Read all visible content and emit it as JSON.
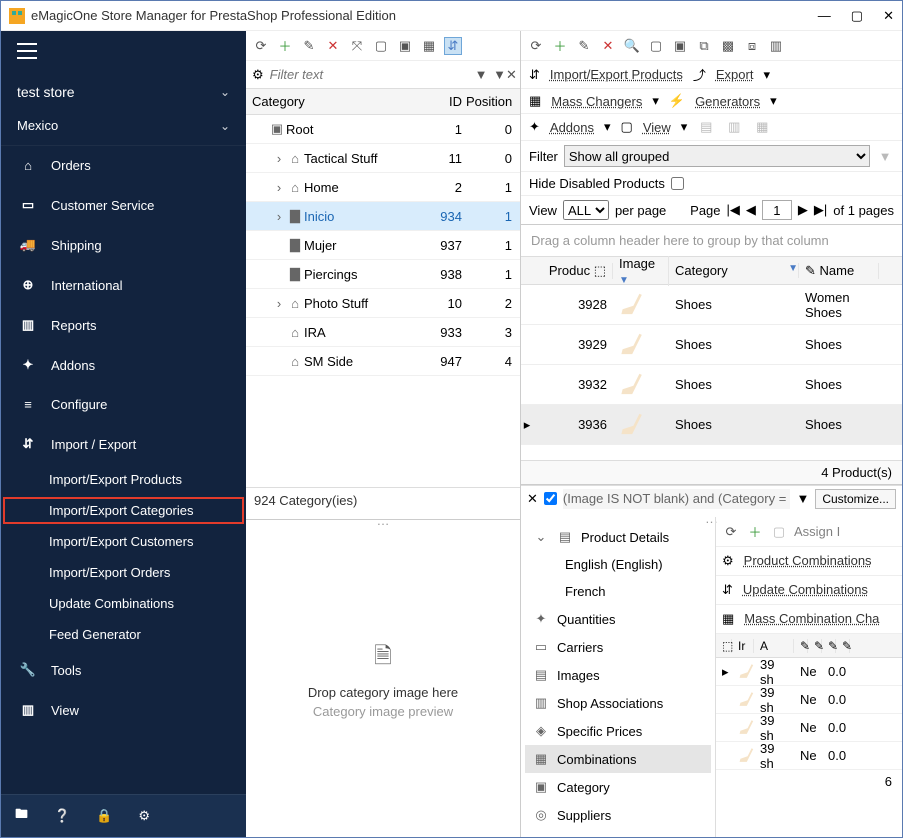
{
  "window": {
    "title": "eMagicOne Store Manager for PrestaShop Professional Edition"
  },
  "sidebar": {
    "store": "test store",
    "region": "Mexico",
    "nav": [
      {
        "icon": "⌂",
        "label": "Orders"
      },
      {
        "icon": "▭",
        "label": "Customer Service"
      },
      {
        "icon": "🚚",
        "label": "Shipping"
      },
      {
        "icon": "⊕",
        "label": "International"
      },
      {
        "icon": "▥",
        "label": "Reports"
      },
      {
        "icon": "✦",
        "label": "Addons"
      },
      {
        "icon": "≡",
        "label": "Configure"
      },
      {
        "icon": "⇵",
        "label": "Import / Export"
      }
    ],
    "subnav": [
      {
        "label": "Import/Export Products"
      },
      {
        "label": "Import/Export Categories",
        "highlight": true
      },
      {
        "label": "Import/Export Customers"
      },
      {
        "label": "Import/Export Orders"
      },
      {
        "label": "Update Combinations"
      },
      {
        "label": "Feed Generator"
      }
    ],
    "nav2": [
      {
        "icon": "🔧",
        "label": "Tools"
      },
      {
        "icon": "▥",
        "label": "View"
      }
    ]
  },
  "categories": {
    "filter_placeholder": "Filter text",
    "cols": {
      "c1": "Category",
      "c2": "ID",
      "c3": "Position"
    },
    "rows": [
      {
        "depth": 0,
        "exp": "",
        "icon": "▣",
        "label": "Root",
        "id": "1",
        "pos": "0"
      },
      {
        "depth": 1,
        "exp": "›",
        "icon": "⌂",
        "label": "Tactical Stuff",
        "id": "11",
        "pos": "0"
      },
      {
        "depth": 1,
        "exp": "›",
        "icon": "⌂",
        "label": "Home",
        "id": "2",
        "pos": "1"
      },
      {
        "depth": 1,
        "exp": "›",
        "icon": "▇",
        "label": "Inicio",
        "id": "934",
        "pos": "1",
        "sel": true
      },
      {
        "depth": 1,
        "exp": "",
        "icon": "▇",
        "label": "Mujer",
        "id": "937",
        "pos": "1"
      },
      {
        "depth": 1,
        "exp": "",
        "icon": "▇",
        "label": "Piercings",
        "id": "938",
        "pos": "1"
      },
      {
        "depth": 1,
        "exp": "›",
        "icon": "⌂",
        "label": "Photo Stuff",
        "id": "10",
        "pos": "2"
      },
      {
        "depth": 1,
        "exp": "",
        "icon": "⌂",
        "label": "IRA",
        "id": "933",
        "pos": "3"
      },
      {
        "depth": 1,
        "exp": "",
        "icon": "⌂",
        "label": "SM Side",
        "id": "947",
        "pos": "4"
      }
    ],
    "footer": "924 Category(ies)",
    "drop": {
      "t1": "Drop category image here",
      "t2": "Category image preview"
    }
  },
  "products": {
    "links": {
      "impexp": "Import/Export Products",
      "export": "Export",
      "mass": "Mass Changers",
      "gen": "Generators",
      "addons": "Addons",
      "view": "View"
    },
    "filter_label": "Filter",
    "filter_value": "Show all grouped",
    "hide_disabled": "Hide Disabled Products",
    "view_row": {
      "view": "View",
      "all": "ALL",
      "perpage": "per page",
      "page": "Page",
      "pagenum": "1",
      "ofpages": "of 1 pages"
    },
    "group_hint": "Drag a column header here to group by that column",
    "cols": {
      "prod": "Produc",
      "img": "Image",
      "cat": "Category",
      "name": "Name"
    },
    "rows": [
      {
        "id": "3928",
        "cat": "Shoes",
        "name": "Women Shoes"
      },
      {
        "id": "3929",
        "cat": "Shoes",
        "name": "Shoes"
      },
      {
        "id": "3932",
        "cat": "Shoes",
        "name": "Shoes"
      },
      {
        "id": "3936",
        "cat": "Shoes",
        "name": "Shoes",
        "sel": true
      }
    ],
    "count": "4 Product(s)",
    "bottom_filter": "(Image IS NOT blank) and (Category = Sh",
    "customize": "Customize..."
  },
  "details": {
    "header": "Product Details",
    "langs": [
      "English (English)",
      "French"
    ],
    "items": [
      {
        "icon": "✦",
        "label": "Quantities"
      },
      {
        "icon": "▭",
        "label": "Carriers"
      },
      {
        "icon": "▤",
        "label": "Images"
      },
      {
        "icon": "▥",
        "label": "Shop Associations"
      },
      {
        "icon": "◈",
        "label": "Specific Prices"
      },
      {
        "icon": "▦",
        "label": "Combinations",
        "sel": true
      },
      {
        "icon": "▣",
        "label": "Category"
      },
      {
        "icon": "◎",
        "label": "Suppliers"
      }
    ]
  },
  "combos": {
    "links": {
      "assign": "Assign I",
      "prodcombo": "Product Combinations",
      "update": "Update Combinations",
      "mass": "Mass Combination Cha"
    },
    "cols": {
      "c1": "Ir",
      "c2": "A"
    },
    "rows": [
      {
        "a": "39 sh",
        "b": "Ne",
        "c": "0.0"
      },
      {
        "a": "39 sh",
        "b": "Ne",
        "c": "0.0"
      },
      {
        "a": "39 sh",
        "b": "Ne",
        "c": "0.0"
      },
      {
        "a": "39 sh",
        "b": "Ne",
        "c": "0.0"
      }
    ],
    "footer": "6"
  }
}
